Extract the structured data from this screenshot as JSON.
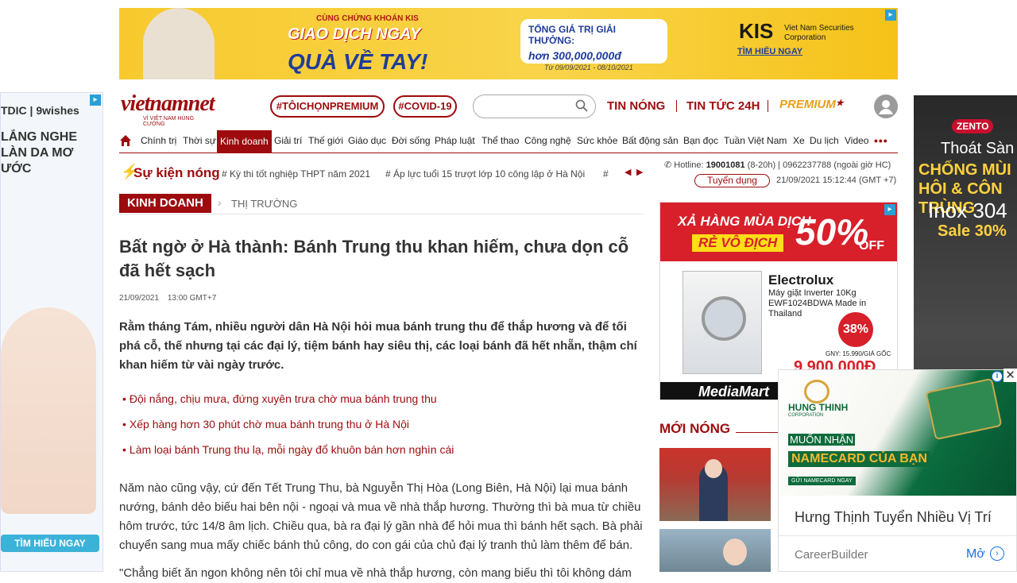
{
  "top_banner": {
    "pre": "CÙNG CHỨNG KHOÁN KIS",
    "line1": "GIAO DỊCH NGAY",
    "line2": "QUÀ VỀ TAY!",
    "box_title": "TỔNG GIÁ TRỊ GIẢI THƯỞNG:",
    "box_value": "hơn 300,000,000đ",
    "dates": "Từ 09/09/2021 - 08/10/2021",
    "brand": "KIS",
    "brand_sub": "Viet Nam Securities Corporation",
    "cta": "TÌM HIỂU NGAY"
  },
  "left_ad": {
    "brand": "TDIC | 9wishes",
    "headline": "LẮNG NGHE LÀN DA MƠ ƯỚC",
    "cta": "TÌM HIỂU NGAY"
  },
  "right_ad": {
    "brand": "ZENTO",
    "l1": "Thoát Sàn",
    "l2": "CHỐNG MÙI HÔI & CÔN TRÙNG",
    "l3": "Inox 304",
    "l4": "Sale 30%"
  },
  "header": {
    "logo": "vietnamnet",
    "logo_tag": "VÌ VIỆT NAM HÙNG CƯỜNG",
    "tags": [
      "#TÔICHỌNPREMIUM",
      "#COVID-19"
    ],
    "search_placeholder": "",
    "links": [
      "TIN NÓNG",
      "TIN TỨC 24H"
    ],
    "premium": "PREMIUM"
  },
  "nav": {
    "items": [
      "Chính trị",
      "Thời sự",
      "Kinh doanh",
      "Giải trí",
      "Thế giới",
      "Giáo dục",
      "Đời sống",
      "Pháp luật",
      "Thể thao",
      "Công nghệ",
      "Sức khỏe",
      "Bất động sản",
      "Bạn đọc",
      "Tuần Việt Nam",
      "Xe",
      "Du lịch",
      "Video"
    ],
    "more": "•••"
  },
  "hot_events": {
    "title": "Sự kiện nóng",
    "items": [
      "# Kỳ thi tốt nghiệp THPT năm 2021",
      "# Áp lực tuổi 15 trượt lớp 10 công lập ở Hà Nội",
      "#"
    ],
    "prev": "◀",
    "next": "▶"
  },
  "contact": {
    "hotline_label": "Hotline:",
    "hotline": "19001081",
    "hotline_rest": "(8-20h) | 0962237788 (ngoài giờ HC)",
    "recruit": "Tuyển dụng",
    "datetime": "21/09/2021 15:12:44 (GMT +7)"
  },
  "breadcrumb": {
    "main": "KINH DOANH",
    "sep": "›",
    "sub": "THỊ TRƯỜNG"
  },
  "article": {
    "title": "Bất ngờ ở Hà thành: Bánh Trung thu khan hiếm, chưa dọn cỗ đã hết sạch",
    "date": "21/09/2021",
    "time": "13:00 GMT+7",
    "lead": "Rằm tháng Tám, nhiều người dân Hà Nội hỏi mua bánh trung thu để thắp hương và để tối phá cỗ, thế nhưng tại các đại lý, tiệm bánh hay siêu thị, các loại bánh đã hết nhẵn, thậm chí khan hiếm từ vài ngày trước.",
    "related": [
      "Đội nắng, chịu mưa, đứng xuyên trưa chờ mua bánh trung thu",
      "Xếp hàng hơn 30 phút chờ mua bánh trung thu ở Hà Nội",
      "Làm loại bánh Trung thu lạ, mỗi ngày đổ khuôn bán hơn nghìn cái"
    ],
    "body": "Năm nào cũng vậy, cứ đến Tết Trung Thu, bà Nguyễn Thị Hòa (Long Biên, Hà Nội) lại mua bánh nướng, bánh dẻo biếu hai bên nội - ngoại và mua về nhà thắp hương. Thường thì bà mua từ chiều hôm trước, tức 14/8 âm lịch. Chiều qua, bà ra đại lý gần nhà để hỏi mua thì bánh hết sạch. Bà phải chuyển sang mua mấy chiếc bánh thủ công, do con gái của chủ đại lý tranh thủ làm thêm để bán.",
    "body2": "\"Chẳng biết ăn ngon không nên tôi chỉ mua về nhà thắp hương, còn mang biếu thì tôi không dám"
  },
  "mid_ad": {
    "t1": "XẢ HÀNG MÙA DỊCH",
    "t2": "RẺ VÔ ĐỊCH",
    "pct": "50%",
    "off": "OFF",
    "brand": "Electrolux",
    "prod": "Máy giặt Inverter 10Kg EWF1024BDWA Made in Thailand",
    "disc": "38%",
    "old": "GNY: 15.990/GIÁ GỐC",
    "price": "9.900.000Đ",
    "store": "MediaMart"
  },
  "hot_news": {
    "title": "MỚI NÓNG"
  },
  "overlay_ad": {
    "company": "HUNG THINH",
    "company_sub": "CORPORATION",
    "line1": "MUỐN NHẬN",
    "line2": "NAMECARD CỦA BẠN",
    "cta_small": "GỬI NAMECARD NGAY",
    "title": "Hưng Thịnh Tuyển Nhiều Vị Trí",
    "source": "CareerBuilder",
    "open": "Mở",
    "close": "✕",
    "info": "i"
  },
  "colors": {
    "brand": "#9d0b0e",
    "premium": "#e8a017",
    "link_blue": "#1a73e8"
  }
}
